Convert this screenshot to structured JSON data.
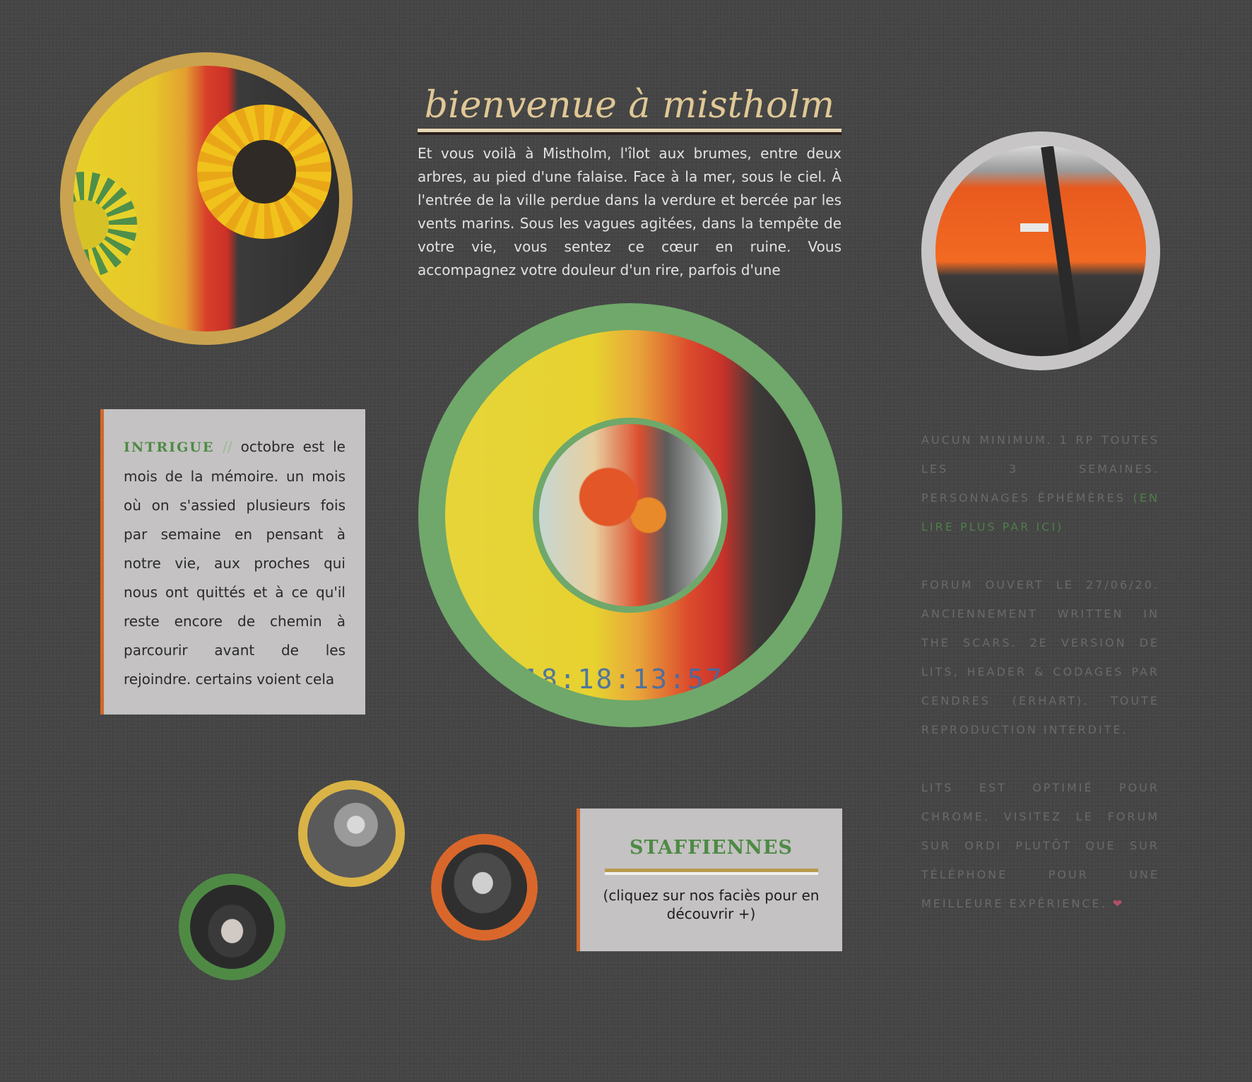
{
  "welcome": {
    "title": "bienvenue à mistholm",
    "text": "Et vous voilà à Mistholm, l'îlot aux brumes, entre deux arbres, au pied d'une falaise. Face à la mer, sous le ciel. À l'entrée de la ville perdue dans la verdure et bercée par les vents marins. Sous les vagues agitées, dans la tempête de votre vie, vous sentez ce cœur en ruine. Vous accompagnez votre douleur d'un rire, parfois d'une"
  },
  "intrigue": {
    "keyword": "INTRIGUE",
    "separator": "//",
    "text": "octobre est le mois de la mémoire. un mois où on s'assied plusieurs fois par semaine en pensant à notre vie, aux proches qui nous ont quittés et à ce qu'il reste encore de chemin à parcourir avant de les rejoindre. certains voient cela"
  },
  "center": {
    "timer": "18:18:13:57"
  },
  "staff": {
    "title": "STAFFIENNES",
    "note": "(cliquez sur nos faciès pour en découvrir +)"
  },
  "info": {
    "p1": "aucun minimum. 1 rp toutes les 3 semaines. personnages éphémères",
    "p1_link": "(en lire plus par ici)",
    "p2": "forum ouvert le 27/06/20. anciennement written in the scars. 2e version de lits, header & codages par cendres (erhart). toute reproduction interdite.",
    "p3": "lits est optimié pour chrome. visitez le forum sur ordi plutôt que sur téléphone pour une meilleure expérience.",
    "heart": "❤"
  },
  "colors": {
    "background": "#454545",
    "gold": "#c9a34f",
    "green": "#6fa86a",
    "orange": "#d0692c",
    "grey_panel": "#c4c2c2"
  }
}
